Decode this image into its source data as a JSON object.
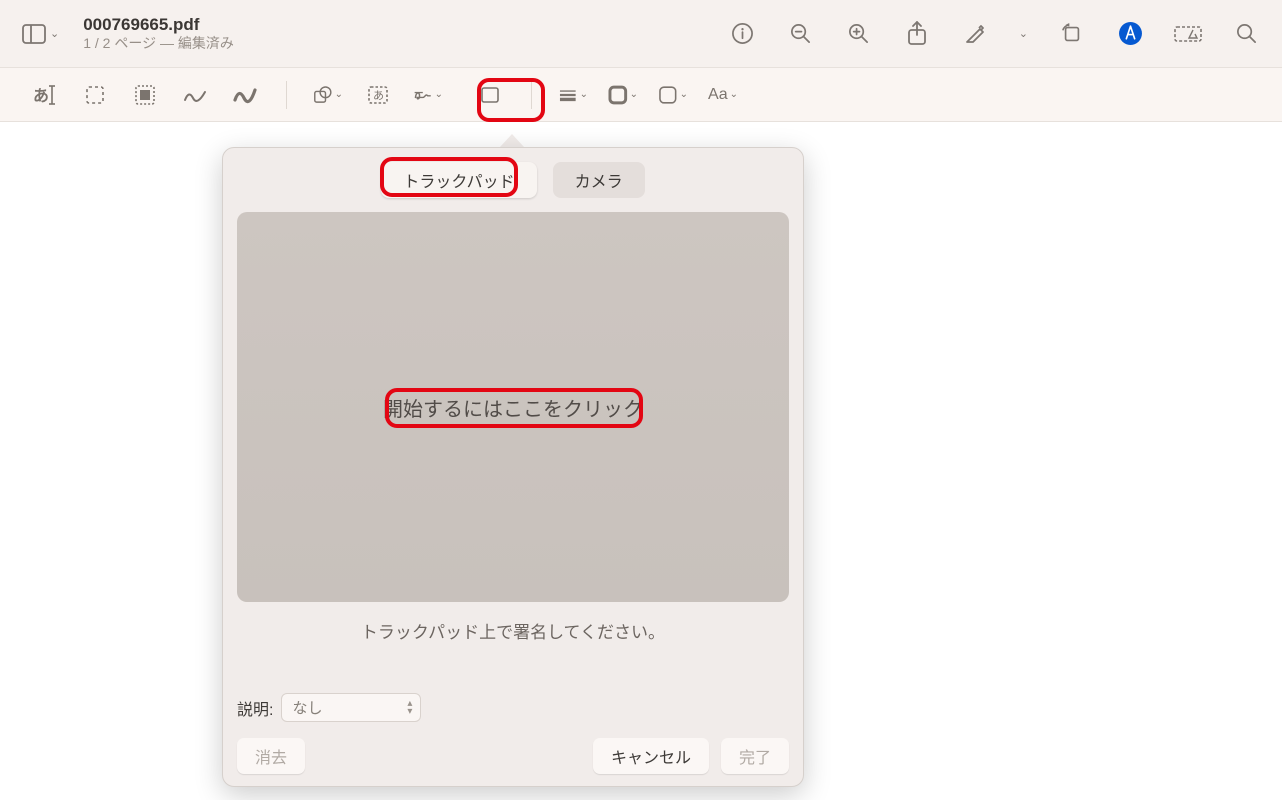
{
  "titlebar": {
    "doc_title": "000769665.pdf",
    "page_status": "1 / 2 ページ — 編集済み"
  },
  "popover": {
    "tabs": {
      "trackpad": "トラックパッド",
      "camera": "カメラ"
    },
    "canvas_prompt": "開始するにはここをクリック",
    "instruction": "トラックパッド上で署名してください。",
    "desc_label": "説明:",
    "desc_value": "なし",
    "btn_clear": "消去",
    "btn_cancel": "キャンセル",
    "btn_done": "完了"
  }
}
